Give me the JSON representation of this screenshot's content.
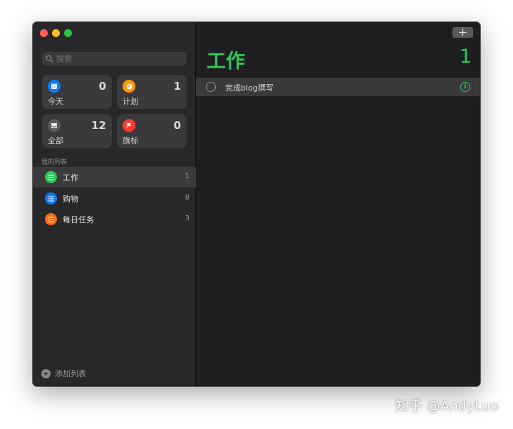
{
  "window": {
    "controls": [
      "close",
      "minimize",
      "zoom"
    ]
  },
  "search": {
    "placeholder": "搜索",
    "value": ""
  },
  "smart_lists": [
    {
      "id": "today",
      "label": "今天",
      "count": "0",
      "icon": "calendar-icon",
      "color": "#0a7aff"
    },
    {
      "id": "scheduled",
      "label": "计划",
      "count": "1",
      "icon": "clock-icon",
      "color": "#ff9500"
    },
    {
      "id": "all",
      "label": "全部",
      "count": "12",
      "icon": "tray-icon",
      "color": "#5b5b5f"
    },
    {
      "id": "flagged",
      "label": "旗标",
      "count": "0",
      "icon": "flag-icon",
      "color": "#ff3b30"
    }
  ],
  "my_lists": {
    "title": "我的列表",
    "items": [
      {
        "label": "工作",
        "count": "1",
        "color": "#30c759",
        "selected": true
      },
      {
        "label": "购物",
        "count": "8",
        "color": "#0a7aff",
        "selected": false
      },
      {
        "label": "每日任务",
        "count": "3",
        "color": "#ff6a14",
        "selected": false
      }
    ]
  },
  "add_list": {
    "label": "添加列表"
  },
  "main": {
    "title": "工作",
    "count": "1",
    "accent": "#30c759",
    "tasks": [
      {
        "text": "完成blog撰写",
        "completed": false
      }
    ]
  },
  "watermark": "知乎 @AndyLuo"
}
